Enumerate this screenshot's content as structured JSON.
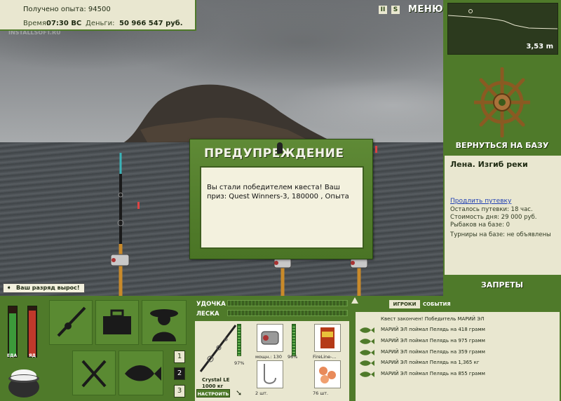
{
  "info": {
    "exp_label": "Получено опыта:",
    "exp_value": "94500",
    "time_label": "Время:",
    "time_value": "07:30 ВС",
    "money_label": "Деньги:",
    "money_value": "50 966 547 руб."
  },
  "watermark": "INSTALLSOFT.RU",
  "controls": {
    "pause": "II",
    "sound": "S",
    "menu": "МЕНЮ"
  },
  "depth": {
    "value": "3,53 m"
  },
  "right_panel": {
    "return_label": "ВЕРНУТЬСЯ НА БАЗУ",
    "location_title": "Лена. Изгиб реки",
    "extend_link": "Продлить путевку",
    "trip_left": "Осталось путевки: 18 час.",
    "day_cost": "Стоимость дня: 29 000 руб.",
    "fishers": "Рыбаков на базе: 0",
    "tournaments": "Турниры на базе: не объявлены",
    "bans_label": "ЗАПРЕТЫ"
  },
  "rank_message": "Ваш разряд вырос!",
  "dialog": {
    "title": "ПРЕДУПРЕЖДЕНИЕ",
    "text": "Вы стали победителем квеста! Ваш приз: Quest Winners-3, 180000 , Опыта"
  },
  "meters": {
    "food_label": "ЕДА",
    "poison_label": "ЯД",
    "food_level": 0.85,
    "poison_level": 0.9
  },
  "slots": {
    "buttons": [
      "1",
      "2",
      "3"
    ]
  },
  "tackle": {
    "rod_label": "УДОЧКА",
    "line_label": "ЛЕСКА",
    "rod_name": "Crystal LE",
    "rod_weight": "1000 кг",
    "rod_condition": "97%",
    "setup_label": "НАСТРОИТЬ",
    "reel_caption": "мощн.: 130",
    "reel_condition": "96%",
    "line_caption": "FireLine-...",
    "hook_caption": "2 шт.",
    "bait_caption": "76 шт."
  },
  "events": {
    "tab_players": "ИГРОКИ",
    "tab_events": "СОБЫТИЯ",
    "items": [
      "Квест закончен! Победитель МАРИЙ ЭЛ",
      "МАРИЙ ЭЛ поймал Пелядь на 418 грамм",
      "МАРИЙ ЭЛ поймал Пелядь на 975 грамм",
      "МАРИЙ ЭЛ поймал Пелядь на 359 грамм",
      "МАРИЙ ЭЛ поймал Пелядь на 1,365 кг",
      "МАРИЙ ЭЛ поймал Пелядь на 855 грамм"
    ]
  },
  "colors": {
    "panel_green": "#4f7a2a",
    "panel_cream": "#e9e7d0",
    "link_blue": "#1f3fb3"
  }
}
